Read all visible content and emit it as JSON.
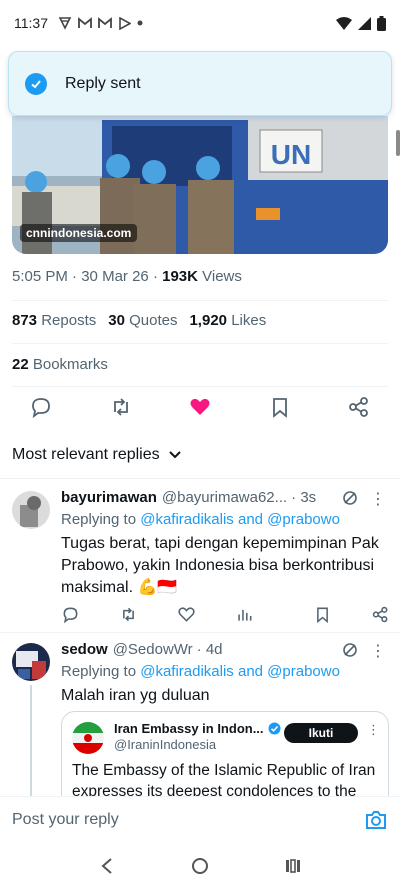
{
  "status_bar": {
    "time": "11:37",
    "notification_icons": [
      "vpn-icon",
      "gmail-icon",
      "gmail-icon",
      "play-icon",
      "dot-icon"
    ],
    "system_icons": [
      "wifi-icon",
      "signal-icon",
      "battery-icon"
    ]
  },
  "toast": {
    "message": "Reply sent",
    "icon": "check-circle-icon",
    "accent": "#1d9bf0"
  },
  "media": {
    "source_label": "cnnindonesia.com",
    "sign_text": "UN"
  },
  "tweet": {
    "time": "5:05 PM",
    "sep": "·",
    "date": "30 Mar 26",
    "views_count": "193K",
    "views_label": "Views",
    "reposts_count": "873",
    "reposts_label": "Reposts",
    "quotes_count": "30",
    "quotes_label": "Quotes",
    "likes_count": "1,920",
    "likes_label": "Likes",
    "bookmarks_count": "22",
    "bookmarks_label": "Bookmarks",
    "liked": true,
    "like_color": "#f91880"
  },
  "sort": {
    "label": "Most relevant replies"
  },
  "replies": [
    {
      "name": "bayurimawan",
      "handle": "@bayurimawa62...",
      "time": "· 3s",
      "replying_prefix": "Replying to",
      "replying_to": "@kafiradikalis and @prabowo",
      "text": "Tugas berat, tapi dengan kepemimpinan Pak Prabowo, yakin Indonesia bisa berkontribusi maksimal. 💪🇮🇩"
    },
    {
      "name": "sedow",
      "handle": "@SedowWr",
      "time": "· 4d",
      "replying_prefix": "Replying to",
      "replying_to": "@kafiradikalis and @prabowo",
      "text": "Malah iran yg duluan",
      "quote": {
        "name": "Iran Embassy in Indon...",
        "handle": "@IraninIndonesia",
        "follow_label": "Ikuti",
        "text": "The Embassy of the Islamic Republic of Iran expresses its deepest condolences to the"
      }
    }
  ],
  "composer": {
    "placeholder": "Post your reply"
  },
  "colors": {
    "link": "#1d9bf0",
    "secondary_text": "#536471"
  }
}
